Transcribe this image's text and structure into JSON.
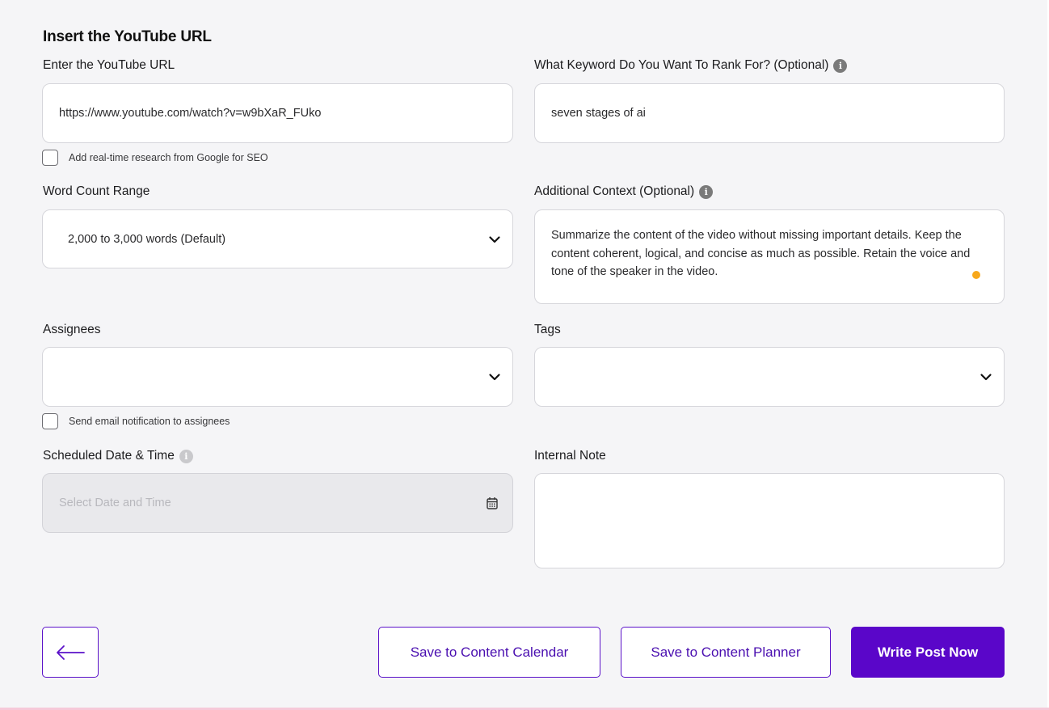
{
  "form": {
    "section_title": "Insert the YouTube URL",
    "youtube_url": {
      "label": "Enter the YouTube URL",
      "value": "https://www.youtube.com/watch?v=w9bXaR_FUko"
    },
    "keyword": {
      "label": "What Keyword Do You Want To Rank For? (Optional)",
      "value": "seven stages of ai",
      "info_icon": "i"
    },
    "google_research": {
      "label": "Add real-time research from Google for SEO",
      "checked": false
    },
    "word_count": {
      "label": "Word Count Range",
      "value": "2,000 to 3,000 words (Default)"
    },
    "additional_context": {
      "label": "Additional Context (Optional)",
      "info_icon": "i",
      "value": "Summarize the content of the video without missing important details. Keep the content coherent, logical, and concise as much as possible. Retain the voice and tone of the speaker in the video."
    },
    "assignees": {
      "label": "Assignees",
      "value": ""
    },
    "tags": {
      "label": "Tags",
      "value": ""
    },
    "email_notification": {
      "label": "Send email notification to assignees",
      "checked": false
    },
    "scheduled": {
      "label": "Scheduled Date & Time",
      "placeholder": "Select Date and Time",
      "info_icon": "i"
    },
    "internal_note": {
      "label": "Internal Note",
      "value": ""
    }
  },
  "actions": {
    "save_calendar": "Save to Content Calendar",
    "save_planner": "Save to Content Planner",
    "write_now": "Write Post Now"
  },
  "colors": {
    "accent": "#5a06c9",
    "background": "#f5f5f7",
    "status_dot": "#f7a81b"
  }
}
